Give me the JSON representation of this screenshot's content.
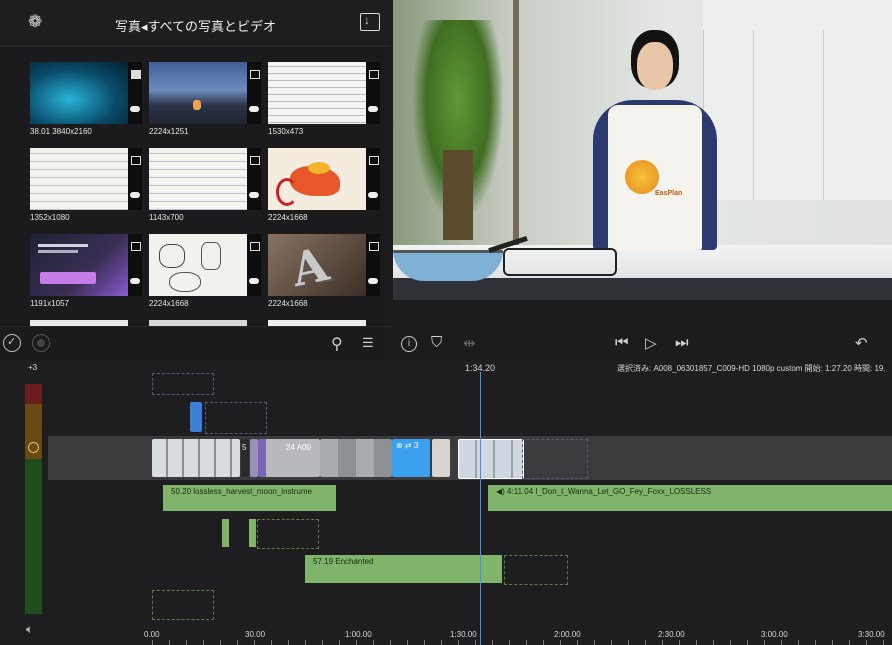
{
  "browser": {
    "title": "写真◂すべての写真とビデオ",
    "thumbnails": [
      {
        "caption": "38.01  3840x2160",
        "kind": "video-ocean"
      },
      {
        "caption": "2224x1251",
        "kind": "photo-night"
      },
      {
        "caption": "1530x473",
        "kind": "screenshot-text"
      },
      {
        "caption": "1352x1080",
        "kind": "screenshot-text"
      },
      {
        "caption": "1143x700",
        "kind": "screenshot-text"
      },
      {
        "caption": "2224x1668",
        "kind": "drawing-dragon"
      },
      {
        "caption": "1191x1057",
        "kind": "screenshot-dark"
      },
      {
        "caption": "2224x1668",
        "kind": "sketch"
      },
      {
        "caption": "2224x1668",
        "kind": "letter-a"
      }
    ]
  },
  "viewer": {
    "transport": [
      "skip-back-icon",
      "play-icon",
      "skip-forward-icon"
    ]
  },
  "timeline": {
    "meter_label": "+3",
    "playhead_time": "1:34.20",
    "selection_info": "選択済み: A008_06301857_C009-HD 1080p custom 開始: 1:27.20 時間: 19.",
    "ruler": [
      "0.00",
      "30.00",
      "1:00.00",
      "1:30.00",
      "2:00.00",
      "2:30.00",
      "3:00.00",
      "3:30.00"
    ],
    "video_clip_labels": [
      "5",
      "24  A00"
    ],
    "audio_clips": [
      {
        "label": "50.20  lossless_harvest_moon_instrume"
      },
      {
        "label": "◀) 4:11.04  I_Don_t_Wanna_Let_GO_Fey_Foxx_LOSSLESS"
      },
      {
        "label": "57.19  Enchanted"
      }
    ]
  }
}
